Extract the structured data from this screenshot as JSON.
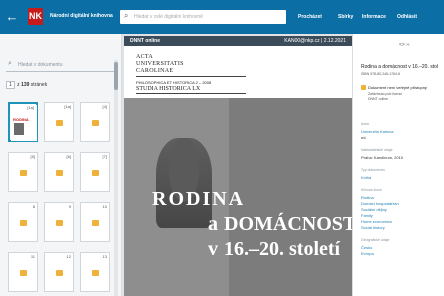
{
  "topbar": {
    "back_icon": "arrow-left-icon",
    "logo_text": "NK",
    "brand": "Národní digitální knihovna",
    "search_placeholder": "Hledat v celé digitální knihovně",
    "nav": [
      "Procházet",
      "Sbírky",
      "Informace",
      "Odhlásit"
    ]
  },
  "sidebar": {
    "search_placeholder": "Hledat v dokumentu",
    "pages_current": "1",
    "pages_label": "z",
    "pages_total": "139",
    "pages_suffix": "stránek",
    "thumbnails": [
      {
        "num": "[1a]"
      },
      {
        "num": "[1a]"
      },
      {
        "num": "[4]"
      },
      {
        "num": "[5]"
      },
      {
        "num": "[6]"
      },
      {
        "num": "[7]"
      },
      {
        "num": "8"
      },
      {
        "num": "9"
      },
      {
        "num": "10"
      },
      {
        "num": "11"
      },
      {
        "num": "12"
      },
      {
        "num": "13"
      }
    ]
  },
  "viewer": {
    "ribbon_left": "DNNT online",
    "ribbon_right": "KAN00@nkp.cz | 2.12.2021",
    "acta": "ACTA\nUNIVERSITATIS\nCAROLINAE",
    "phil": "PHILOSOPHICA ET HISTORICA 2 – 2008",
    "studia": "STUDIA HISTORICA LX",
    "title_rodina": "RODINA",
    "title_a": "a",
    "title_domacnost": "DOMÁCNOST",
    "title_v": "v",
    "title_century": "16.–20. století"
  },
  "rpanel": {
    "pager": "<>   ››",
    "title": "Rodina a domácnost v 16.–20. stol",
    "isbn": "ISBN 978-80-246-1764-6",
    "access": "Dokument není veřejně přístupný",
    "avail": "Zaškrtnuto pod licencí",
    "avail2": "DNNT online",
    "author_label": "Autor",
    "author": "Univerzita Karlova",
    "author_note": "ed.",
    "publisher_label": "Nakladatelské údaje",
    "publisher": "Praha: Karolinum, 2010",
    "type_label": "Typ dokumentu",
    "type": "Kniha",
    "keywords_label": "Klíčová slova",
    "keywords": [
      "Rodina",
      "Domácí hospodářství",
      "Sociální dějiny",
      "Family",
      "Home economics",
      "Social history"
    ],
    "geo_label": "Geografické údaje",
    "geo": [
      "Česko",
      "Evropa"
    ]
  },
  "colors": {
    "topbar": "#0b6fa6",
    "accent": "#1f93b8",
    "brand_red": "#c71a1a",
    "lock": "#f0b13b"
  }
}
